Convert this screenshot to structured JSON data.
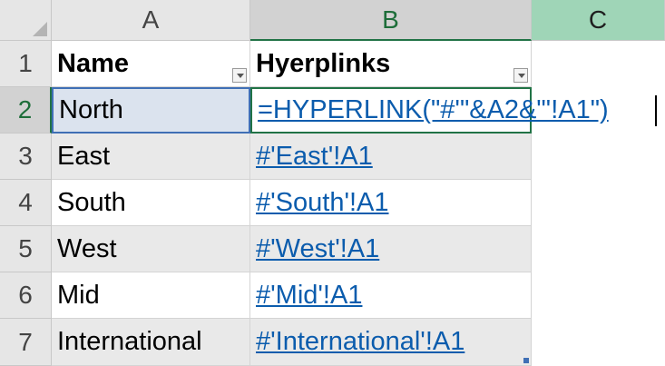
{
  "columns": [
    "A",
    "B",
    "C"
  ],
  "rows": [
    "1",
    "2",
    "3",
    "4",
    "5",
    "6",
    "7"
  ],
  "table": {
    "headers": [
      "Name",
      "Hyerplinks"
    ],
    "editing_formula": "=HYPERLINK(\"#'\"&A2&\"'!A1\")",
    "rows": [
      {
        "name": "North",
        "link": ""
      },
      {
        "name": "East",
        "link": "#'East'!A1"
      },
      {
        "name": "South",
        "link": "#'South'!A1"
      },
      {
        "name": "West",
        "link": "#'West'!A1"
      },
      {
        "name": "Mid",
        "link": "#'Mid'!A1"
      },
      {
        "name": "International",
        "link": "#'International'!A1"
      }
    ]
  },
  "colors": {
    "active_header_green": "#217346",
    "hyperlink_blue": "#0b5cad",
    "band_gray": "#e9e9e9"
  },
  "icons": [
    "select-all-corner-icon",
    "filter-dropdown-icon"
  ]
}
